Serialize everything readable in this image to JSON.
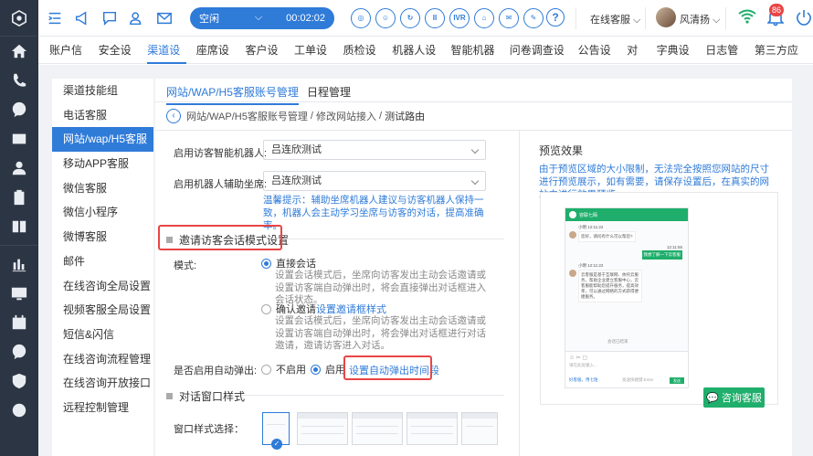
{
  "topbar": {
    "status": "空闲",
    "timer": "00:02:02",
    "controls": [
      "◎",
      "☺",
      "↻",
      "II",
      "IVR",
      "⌂",
      "✉",
      "✎"
    ],
    "online_status": "在线客服",
    "user_name": "风清扬",
    "notification_count": "86"
  },
  "nav": {
    "tabs": [
      "账户信息",
      "安全设置",
      "渠道设置",
      "座席设置",
      "客户设置",
      "工单设置",
      "质检设置",
      "机器人设置",
      "智能机器人",
      "问卷调查设置",
      "公告设置",
      "对接",
      "字典设置",
      "日志管理",
      "第三方应用"
    ]
  },
  "subnav": {
    "items": [
      "渠道技能组",
      "电话客服",
      "网站/wap/H5客服",
      "移动APP客服",
      "微信客服",
      "微信小程序",
      "微博客服",
      "邮件",
      "在线咨询全局设置",
      "视频客服全局设置",
      "短信&闪信",
      "在线咨询流程管理",
      "在线咨询开放接口",
      "远程控制管理"
    ]
  },
  "panel": {
    "tabs": [
      "网站/WAP/H5客服账号管理",
      "日程管理"
    ],
    "breadcrumb": {
      "part1": "网站/WAP/H5客服账号管理",
      "sep1": " / ",
      "part2": "修改网站接入",
      "sep2": " / ",
      "current": "测试路由"
    }
  },
  "form": {
    "robot_label": "启用访客智能机器人:",
    "robot_value": "吕连欣测试",
    "assist_label": "启用机器人辅助坐席:",
    "assist_value": "吕连欣测试",
    "hint": "温馨提示：辅助坐席机器人建议与访客机器人保持一致，机器人会主动学习坐席与访客的对话，提高准确率。",
    "invite_section": "邀请访客会话模式设置",
    "mode_label": "模式:",
    "direct_label": "直接会话",
    "direct_desc": "设置会话模式后，坐席向访客发出主动会话邀请或设置访客端自动弹出时，将会直接弹出对话框进入会话状态。",
    "confirm_label": "确认邀请",
    "confirm_link": "设置邀请框样式",
    "confirm_desc": "设置会话模式后，坐席向访客发出主动会话邀请或设置访客端自动弹出时，将会弹出对话框进行对话邀请，邀请访客进入对话。",
    "popup_label": "是否启用自动弹出:",
    "popup_off": "不启用",
    "popup_on": "启用",
    "popup_link": "设置自动弹出时间段",
    "window_section": "对话窗口样式",
    "window_label": "窗口样式选择："
  },
  "preview": {
    "title": "预览效果",
    "desc": "由于预览区域的大小限制，无法完全按照您网站的尺寸进行预览展示，如有需要，请保存设置后，在真实的网站中进行效果预览。",
    "chat_title": "容联七陌",
    "time1": "小明 12:11:22",
    "msg1": "您好，请问有什么可以帮您?",
    "time2": "12:11:56",
    "msg2": "我想了解一下云客服",
    "time3": "小明 12:11:22",
    "msg3": "云客服是基于互联网、依托云服务，帮助企业建立客服中心，云客服能帮助您提升服务，提高效率，可以通过网络的方式获得便捷服务。",
    "ended": "会话已结束",
    "input_placeholder": "请在此处输入...",
    "foot_text": "好客服，用七陌",
    "send_hint": "发送快捷键:Enter",
    "send": "发送",
    "consult_button": "咨询客服"
  },
  "colors": {
    "primary": "#2f7bd8",
    "sidebar": "#2c3544",
    "accent_green": "#1fae6b",
    "highlight_red": "#e84545"
  }
}
